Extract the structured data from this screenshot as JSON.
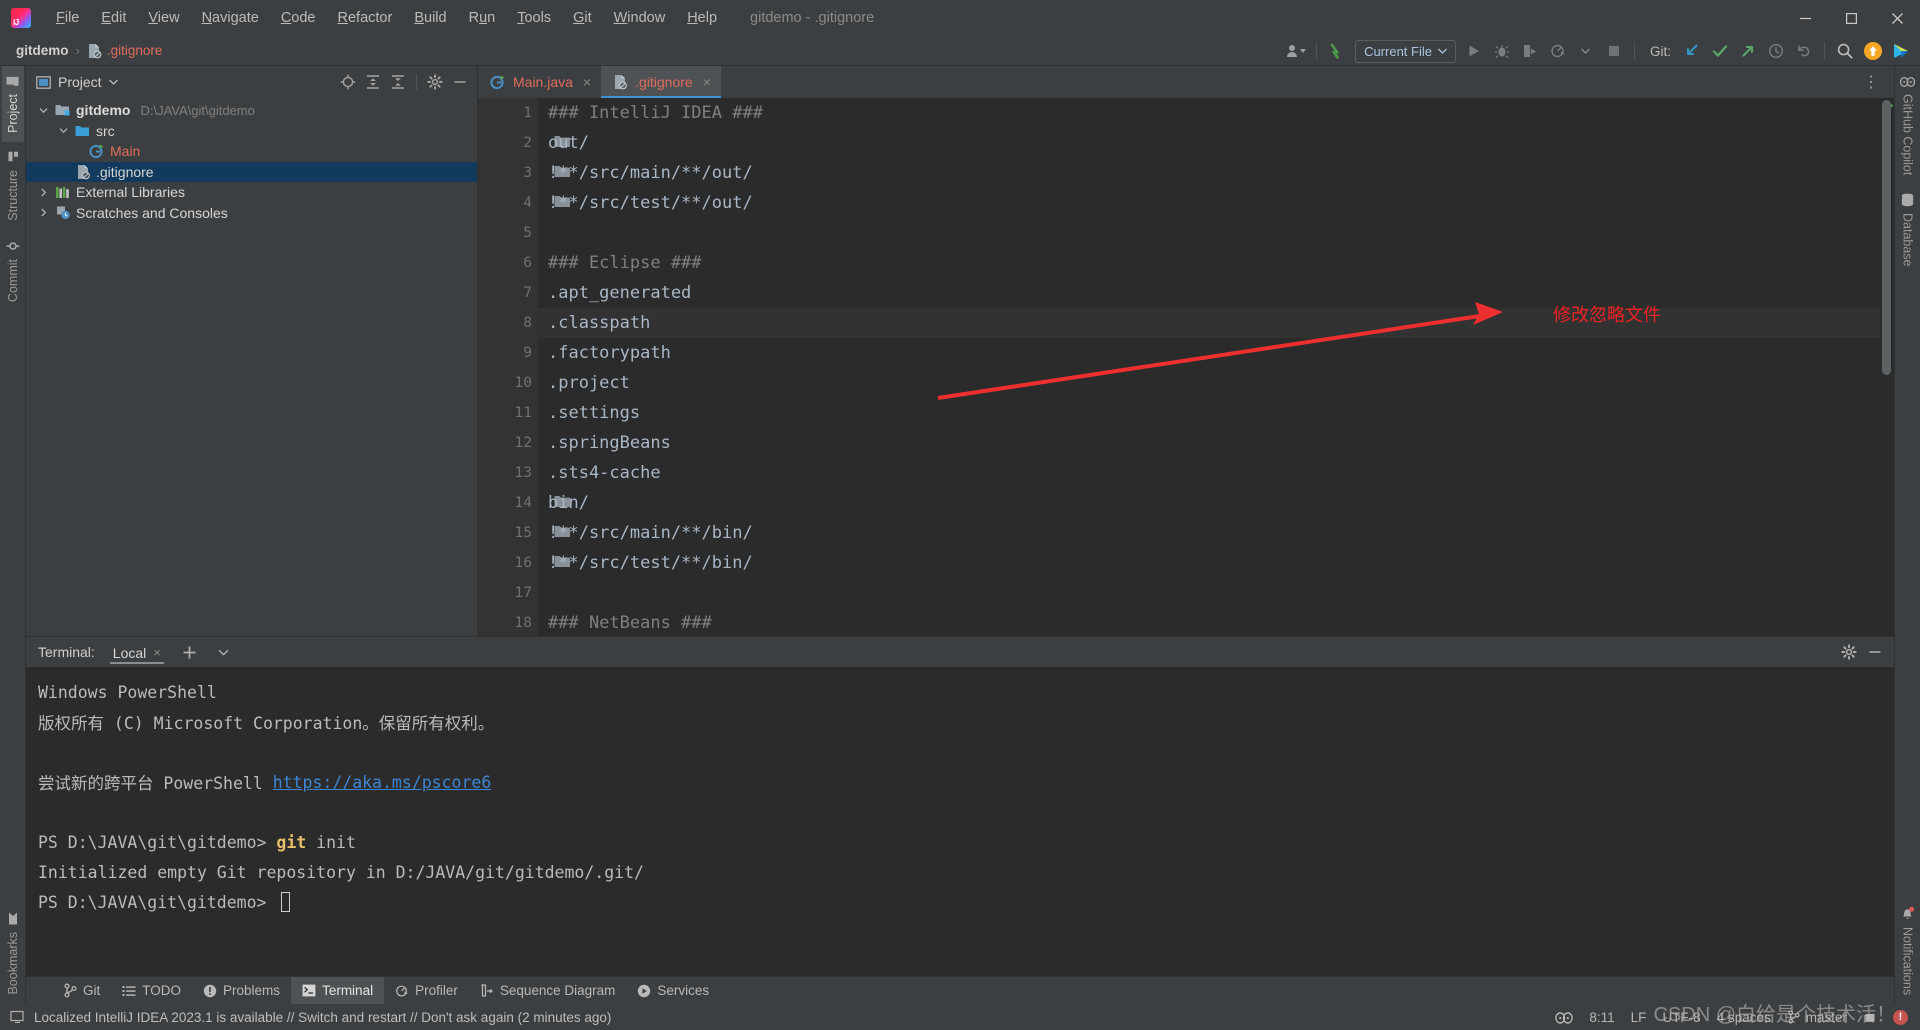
{
  "window": {
    "title": "gitdemo - .gitignore",
    "logo_icon": "intellij-idea-logo",
    "minimize_label": "Minimize",
    "maximize_label": "Maximize",
    "close_label": "Close"
  },
  "menu": {
    "items": [
      {
        "label": "File"
      },
      {
        "label": "Edit"
      },
      {
        "label": "View"
      },
      {
        "label": "Navigate"
      },
      {
        "label": "Code"
      },
      {
        "label": "Refactor"
      },
      {
        "label": "Build"
      },
      {
        "label": "Run"
      },
      {
        "label": "Tools"
      },
      {
        "label": "Git"
      },
      {
        "label": "Window"
      },
      {
        "label": "Help"
      }
    ]
  },
  "navbar": {
    "breadcrumb": [
      {
        "label": "gitdemo",
        "type": "project"
      },
      {
        "label": ".gitignore",
        "type": "file"
      }
    ],
    "separator": "›",
    "run_config": "Current File",
    "git_label": "Git:",
    "icons": {
      "account": "user-account-icon",
      "updates": "update-project-icon",
      "run": "run-icon",
      "debug": "debug-icon",
      "coverage": "run-with-coverage-icon",
      "profiler": "profiler-icon",
      "stop": "stop-icon",
      "update": "git-update-icon",
      "commit": "git-commit-icon",
      "push": "git-push-icon",
      "history": "git-history-icon",
      "rollback": "git-rollback-icon",
      "search": "search-everywhere-icon",
      "ai": "ai-assistant-icon",
      "copilot": "github-copilot-icon"
    }
  },
  "left_stripe": {
    "items": [
      {
        "label": "Project",
        "icon": "project-folder-icon",
        "active": true
      },
      {
        "label": "Structure",
        "icon": "structure-icon",
        "active": false
      },
      {
        "label": "Commit",
        "icon": "commit-icon",
        "active": false
      }
    ],
    "bottom_items": [
      {
        "label": "Bookmarks",
        "icon": "bookmark-icon",
        "active": false
      }
    ]
  },
  "right_stripe": {
    "items": [
      {
        "label": "GitHub Copilot",
        "icon": "github-copilot-icon",
        "active": false
      },
      {
        "label": "Database",
        "icon": "database-icon",
        "active": false
      }
    ],
    "bottom_items": [
      {
        "label": "Notifications",
        "icon": "notifications-bell-icon",
        "active": false
      }
    ]
  },
  "project_tool_window": {
    "title": "Project",
    "title_icon": "project-view-icon",
    "dropdown_icon": "chevron-down-icon",
    "actions": [
      {
        "name": "select-opened-file-icon",
        "label": "Select Opened File"
      },
      {
        "name": "expand-all-icon",
        "label": "Expand All"
      },
      {
        "name": "collapse-all-icon",
        "label": "Collapse All"
      },
      {
        "name": "settings-gear-icon",
        "label": "Options"
      },
      {
        "name": "hide-icon",
        "label": "Hide"
      }
    ],
    "tree": [
      {
        "label": "gitdemo",
        "sub": "D:\\JAVA\\git\\gitdemo",
        "indent": 0,
        "expanded": true,
        "icon": "module-folder-icon",
        "bold": true,
        "selected": false
      },
      {
        "label": "src",
        "sub": "",
        "indent": 1,
        "expanded": true,
        "icon": "source-folder-icon",
        "bold": false,
        "selected": false
      },
      {
        "label": "Main",
        "sub": "",
        "indent": 2,
        "expanded": null,
        "icon": "java-class-icon",
        "bold": false,
        "selected": false,
        "red": true
      },
      {
        "label": ".gitignore",
        "sub": "",
        "indent": 1,
        "expanded": null,
        "icon": "gitignore-file-icon",
        "bold": false,
        "selected": true
      },
      {
        "label": "External Libraries",
        "sub": "",
        "indent": 0,
        "expanded": false,
        "icon": "external-libraries-icon",
        "bold": false,
        "selected": false
      },
      {
        "label": "Scratches and Consoles",
        "sub": "",
        "indent": 0,
        "expanded": false,
        "icon": "scratches-icon",
        "bold": false,
        "selected": false
      }
    ]
  },
  "editor": {
    "tabs": [
      {
        "label": "Main.java",
        "icon": "java-class-icon",
        "active": false,
        "close": "×"
      },
      {
        "label": ".gitignore",
        "icon": "gitignore-file-icon",
        "active": true,
        "close": "×"
      }
    ],
    "more_tabs_icon": "more-options-icon",
    "current_line": 8,
    "lines": [
      {
        "n": 1,
        "text": "### IntelliJ IDEA ###",
        "comment": true,
        "folder": false
      },
      {
        "n": 2,
        "text": "out/",
        "comment": false,
        "folder": true
      },
      {
        "n": 3,
        "text": "!**/src/main/**/out/",
        "comment": false,
        "folder": true
      },
      {
        "n": 4,
        "text": "!**/src/test/**/out/",
        "comment": false,
        "folder": true
      },
      {
        "n": 5,
        "text": "",
        "comment": false,
        "folder": false
      },
      {
        "n": 6,
        "text": "### Eclipse ###",
        "comment": true,
        "folder": false
      },
      {
        "n": 7,
        "text": ".apt_generated",
        "comment": false,
        "folder": false
      },
      {
        "n": 8,
        "text": ".classpath",
        "comment": false,
        "folder": false
      },
      {
        "n": 9,
        "text": ".factorypath",
        "comment": false,
        "folder": false
      },
      {
        "n": 10,
        "text": ".project",
        "comment": false,
        "folder": false
      },
      {
        "n": 11,
        "text": ".settings",
        "comment": false,
        "folder": false
      },
      {
        "n": 12,
        "text": ".springBeans",
        "comment": false,
        "folder": false
      },
      {
        "n": 13,
        "text": ".sts4-cache",
        "comment": false,
        "folder": false
      },
      {
        "n": 14,
        "text": "bin/",
        "comment": false,
        "folder": true
      },
      {
        "n": 15,
        "text": "!**/src/main/**/bin/",
        "comment": false,
        "folder": true
      },
      {
        "n": 16,
        "text": "!**/src/test/**/bin/",
        "comment": false,
        "folder": true
      },
      {
        "n": 17,
        "text": "",
        "comment": false,
        "folder": false
      },
      {
        "n": 18,
        "text": "### NetBeans ###",
        "comment": true,
        "folder": false
      }
    ],
    "inspection_status_icon": "inspections-ok-icon"
  },
  "annotation": {
    "text": "修改忽略文件",
    "color": "#ee2222",
    "arrow": "red-arrow-pointing-left"
  },
  "terminal": {
    "header_title": "Terminal:",
    "tab_label": "Local",
    "tab_close": "×",
    "add_icon": "add-tab-icon",
    "chevron_icon": "chevron-down-icon",
    "settings_icon": "settings-gear-icon",
    "hide_icon": "hide-icon",
    "lines": [
      {
        "type": "plain",
        "text": "Windows PowerShell"
      },
      {
        "type": "plain",
        "text": "版权所有 (C) Microsoft Corporation。保留所有权利。"
      },
      {
        "type": "plain",
        "text": ""
      },
      {
        "type": "link",
        "prefix": "尝试新的跨平台 PowerShell ",
        "link": "https://aka.ms/pscore6"
      },
      {
        "type": "plain",
        "text": ""
      },
      {
        "type": "command",
        "prompt": "PS D:\\JAVA\\git\\gitdemo> ",
        "cmd": "git",
        "args": " init"
      },
      {
        "type": "plain",
        "text": "Initialized empty Git repository in D:/JAVA/git/gitdemo/.git/"
      },
      {
        "type": "prompt",
        "prompt": "PS D:\\JAVA\\git\\gitdemo> "
      }
    ]
  },
  "bottom_toolbar": {
    "items": [
      {
        "label": "Git",
        "icon": "git-branch-icon",
        "active": false
      },
      {
        "label": "TODO",
        "icon": "todo-list-icon",
        "active": false
      },
      {
        "label": "Problems",
        "icon": "problems-icon",
        "active": false
      },
      {
        "label": "Terminal",
        "icon": "terminal-icon",
        "active": true
      },
      {
        "label": "Profiler",
        "icon": "profiler-icon",
        "active": false
      },
      {
        "label": "Sequence Diagram",
        "icon": "sequence-diagram-icon",
        "active": false
      },
      {
        "label": "Services",
        "icon": "services-icon",
        "active": false
      }
    ]
  },
  "status_bar": {
    "icon": "ide-message-icon",
    "message": "Localized IntelliJ IDEA 2023.1 is available // Switch and restart // Don't ask again (2 minutes ago)",
    "copilot_icon": "github-copilot-icon",
    "caret_position": "8:11",
    "line_separator": "LF",
    "encoding": "UTF-8",
    "indent": "4 spaces",
    "branch": "master",
    "branch_icon": "git-branch-icon",
    "lock_icon": "read-only-toggle-icon",
    "error_badge": "!",
    "watermark": "CSDN @白给是个技术活！"
  }
}
